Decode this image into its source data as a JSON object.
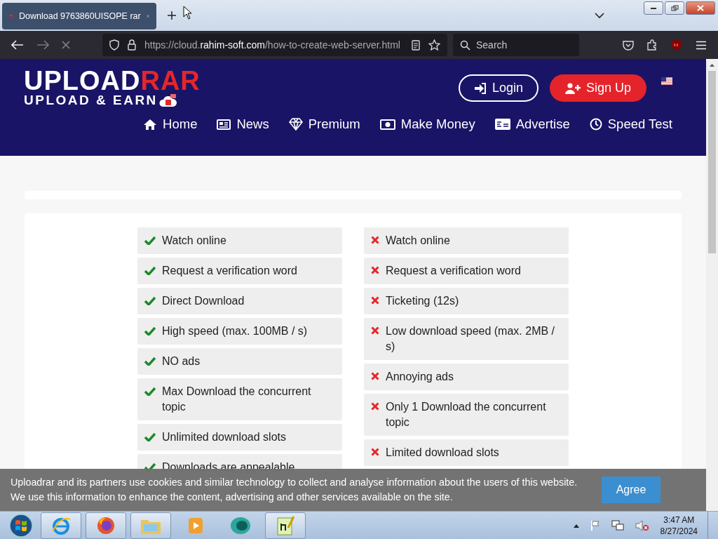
{
  "browser": {
    "tab_title": "Download 9763860UISOPE rar",
    "url_prefix": "https://cloud.",
    "url_domain": "rahim-soft.com",
    "url_path": "/how-to-create-web-server.html",
    "search_placeholder": "Search"
  },
  "header": {
    "logo_word": "UPLOAD",
    "logo_accent": "RAR",
    "tagline": "UPLOAD & EARN",
    "login": "Login",
    "signup": "Sign Up",
    "nav": [
      {
        "label": "Home"
      },
      {
        "label": "News"
      },
      {
        "label": "Premium"
      },
      {
        "label": "Make Money"
      },
      {
        "label": "Advertise"
      },
      {
        "label": "Speed Test"
      }
    ]
  },
  "features": {
    "premium": [
      {
        "text": "Watch online",
        "included": true
      },
      {
        "text": "Request a verification word",
        "included": true
      },
      {
        "text": "Direct Download",
        "included": true
      },
      {
        "text": "High speed (max. 100MB / s)",
        "included": true
      },
      {
        "text": "NO ads",
        "included": true
      },
      {
        "text": "Max Download the concurrent topic",
        "included": true
      },
      {
        "text": "Unlimited download slots",
        "included": true
      },
      {
        "text": "Downloads are appealable",
        "included": true
      }
    ],
    "free": [
      {
        "text": "Watch online",
        "included": false
      },
      {
        "text": "Request a verification word",
        "included": false
      },
      {
        "text": "Ticketing (12s)",
        "included": false
      },
      {
        "text": "Low download speed (max. 2MB / s)",
        "included": false
      },
      {
        "text": "Annoying ads",
        "included": false
      },
      {
        "text": "Only 1 Download the concurrent topic",
        "included": false
      },
      {
        "text": "Limited download slots",
        "included": false
      }
    ]
  },
  "cookie_banner": {
    "lines": [
      "Uploadrar and its partners use cookies and similar technology to collect and analyse information about the users of this website.",
      "We use this information to enhance the content, advertising and other services available on the site."
    ],
    "button": "Agree"
  },
  "taskbar": {
    "time": "3:47 AM",
    "date": "8/27/2024"
  }
}
